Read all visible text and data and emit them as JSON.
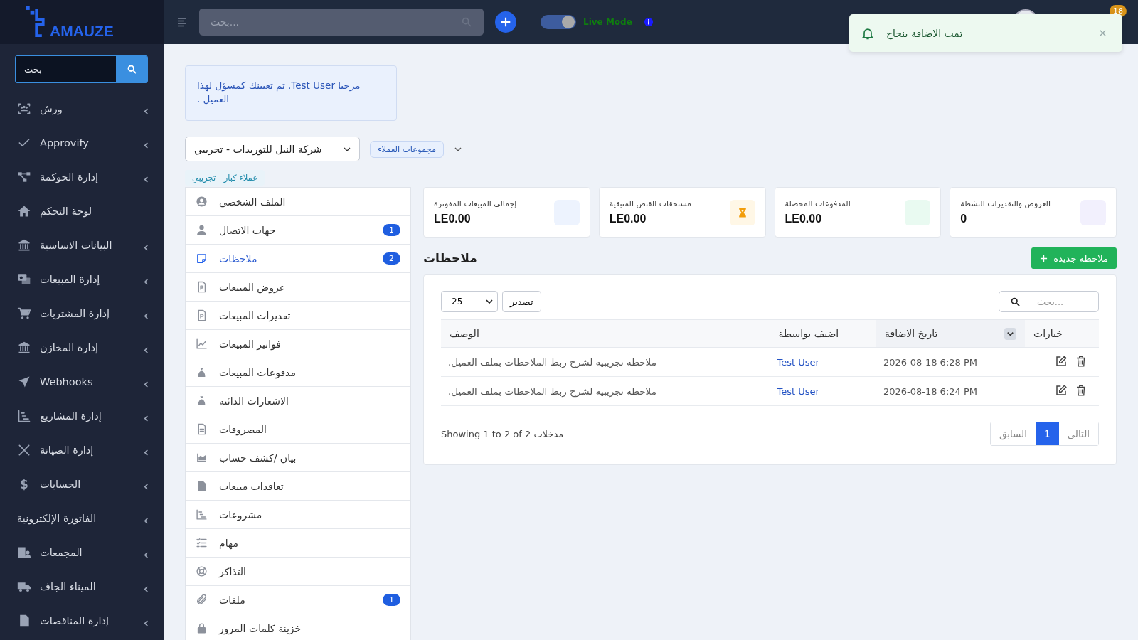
{
  "sidebar": {
    "logo": "AMAUZE",
    "search": {
      "placeholder": "بحث"
    },
    "items": [
      {
        "label": "ورش",
        "expandable": true
      },
      {
        "label": "Approvify",
        "expandable": true
      },
      {
        "label": "إدارة الحوكمة",
        "expandable": true
      },
      {
        "label": "لوحة التحكم",
        "expandable": false
      },
      {
        "label": "البيانات الاساسية",
        "expandable": true
      },
      {
        "label": "إدارة المبيعات",
        "expandable": true
      },
      {
        "label": "إدارة المشتريات",
        "expandable": true
      },
      {
        "label": "إدارة المخازن",
        "expandable": true
      },
      {
        "label": "Webhooks",
        "expandable": true
      },
      {
        "label": "إدارة المشاريع",
        "expandable": true
      },
      {
        "label": "إدارة الصيانة",
        "expandable": true
      },
      {
        "label": "الحسابات",
        "expandable": true,
        "icon_text": "$"
      },
      {
        "label": "الفاتورة الإلكترونية",
        "expandable": true
      },
      {
        "label": "المجمعات",
        "expandable": true
      },
      {
        "label": "الميناء الجاف",
        "expandable": true
      },
      {
        "label": "إدارة المناقصات",
        "expandable": true
      }
    ]
  },
  "topbar": {
    "search": {
      "placeholder": "...بحث"
    },
    "live_mode": {
      "on": true,
      "label": "Live Mode"
    },
    "notifications": "18"
  },
  "toast": {
    "message": "تمت الاضافة بنجاح"
  },
  "welcome": "مرحبا Test User. تم تعيينك كمسؤل لهذا العميل .",
  "customer_select": {
    "value": "شركة النيل للتوريدات - تجريبي"
  },
  "groups_button": "مجموعات العملاء",
  "group_tag": "عملاء كبار - تجريبي",
  "customer_menu": [
    {
      "label": "الملف الشخصى",
      "selected": false
    },
    {
      "label": "جهات الاتصال",
      "selected": false,
      "badge": "1"
    },
    {
      "label": "ملاحظات",
      "selected": true,
      "badge": "2"
    },
    {
      "label": "عروض المبيعات",
      "selected": false
    },
    {
      "label": "تقديرات المبيعات",
      "selected": false
    },
    {
      "label": "فواتير المبيعات",
      "selected": false
    },
    {
      "label": "مدفوعات المبيعات",
      "selected": false
    },
    {
      "label": "الاشعارات الدائنة",
      "selected": false
    },
    {
      "label": "المصروفات",
      "selected": false
    },
    {
      "label": "بيان /كشف حساب",
      "selected": false
    },
    {
      "label": "تعاقدات مبيعات",
      "selected": false
    },
    {
      "label": "مشروعات",
      "selected": false
    },
    {
      "label": "مهام",
      "selected": false
    },
    {
      "label": "التذاكر",
      "selected": false
    },
    {
      "label": "ملفات",
      "selected": false,
      "badge": "1"
    },
    {
      "label": "خزينة كلمات المرور",
      "selected": false
    }
  ],
  "stats": [
    {
      "label": "العروض والتقديرات النشطة",
      "value": "0",
      "color": "#f2f0fd"
    },
    {
      "label": "المدفوعات المحصلة",
      "value": "LE0.00",
      "color": "#e9faf1"
    },
    {
      "label": "مستحقات القبض المتبقية",
      "value": "LE0.00",
      "color": "#fff7e6"
    },
    {
      "label": "إجمالي المبيعات المفوترة",
      "value": "LE0.00",
      "color": "#edf3fe"
    }
  ],
  "notes": {
    "title": "ملاحظات",
    "new_button": "ملاحظة جديدة",
    "page_size": "25",
    "export": "تصدير",
    "search_placeholder": "...بحث",
    "columns": [
      "خيارات",
      "تاريخ الاضافة",
      "اضيف بواسطة",
      "الوصف"
    ],
    "rows": [
      {
        "description": "ملاحظة تجريبية لشرح ربط الملاحظات بملف العميل.",
        "added_by": "Test User",
        "date": "2026-08-18 6:28 PM"
      },
      {
        "description": "ملاحظة تجريبية لشرح ربط الملاحظات بملف العميل.",
        "added_by": "Test User",
        "date": "2026-08-18 6:24 PM"
      }
    ],
    "summary": "Showing 1 to 2 of 2 مدخلات",
    "pagination": [
      {
        "label": "التالى",
        "selected": false
      },
      {
        "label": "1",
        "selected": true
      },
      {
        "label": "السابق",
        "selected": false
      }
    ]
  }
}
